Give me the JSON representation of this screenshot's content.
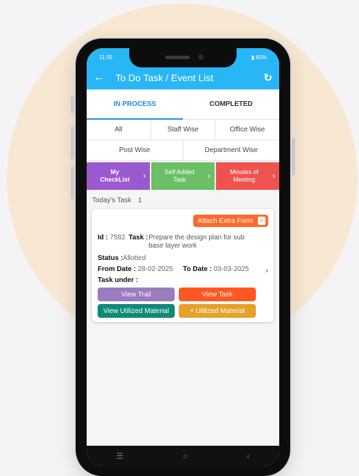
{
  "status_bar": {
    "time": "11:35",
    "battery": "60%"
  },
  "header": {
    "title": "To Do Task / Event List",
    "back_icon": "arrow-left",
    "refresh_icon": "refresh"
  },
  "tabs": [
    {
      "label": "IN PROCESS",
      "active": true
    },
    {
      "label": "COMPLETED",
      "active": false
    }
  ],
  "filters": {
    "row1": [
      "All",
      "Staff Wise",
      "Office Wise"
    ],
    "row2": [
      "Post Wise",
      "Department Wise"
    ]
  },
  "categories": [
    {
      "line1": "My",
      "line2": "CheckList",
      "color": "#9b59d0"
    },
    {
      "line1": "Self Added",
      "line2": "Task",
      "color": "#6dbf67"
    },
    {
      "line1": "Minutes of",
      "line2": "Meeting",
      "color": "#ef5350"
    }
  ],
  "today": {
    "label": "Today's Task",
    "count": "1"
  },
  "task_card": {
    "attach_label": "Attach Extra Form",
    "id_label": "Id :",
    "id_value": "7582",
    "task_label": "Task :",
    "task_value": "Prepare the design plan for sub base layer work",
    "status_label": "Status :",
    "status_value": "Allotted",
    "from_label": "From Date :",
    "from_value": "28-02-2025",
    "to_label": "To Date :",
    "to_value": "03-03-2025",
    "under_label": "Task under :",
    "buttons": {
      "view_trail": "View Trail",
      "view_task": "View Task",
      "view_utilized": "View Utilized Material",
      "add_utilized": "+ Utilized Material"
    }
  },
  "colors": {
    "accent": "#29b6f6",
    "trail": "#9c7bbf",
    "task": "#ff5722",
    "utilized": "#0f8a78",
    "add": "#e6a12a"
  }
}
